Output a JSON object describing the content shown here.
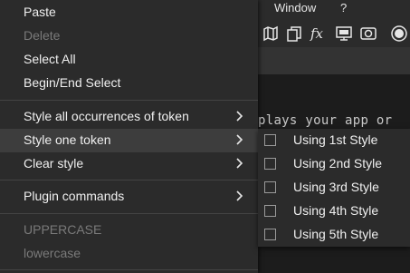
{
  "app": {
    "menubar": {
      "window_label": "Window",
      "help_label": "?"
    },
    "editor_text": "plays your app or"
  },
  "context_menu": {
    "items": [
      {
        "label": "Paste",
        "enabled": true
      },
      {
        "label": "Delete",
        "enabled": false
      },
      {
        "label": "Select All",
        "enabled": true
      },
      {
        "label": "Begin/End Select",
        "enabled": true
      },
      {
        "label": "Style all occurrences of token",
        "enabled": true,
        "submenu": true
      },
      {
        "label": "Style one token",
        "enabled": true,
        "submenu": true,
        "highlighted": true
      },
      {
        "label": "Clear style",
        "enabled": true,
        "submenu": true
      },
      {
        "label": "Plugin commands",
        "enabled": true,
        "submenu": true
      },
      {
        "label": "UPPERCASE",
        "enabled": false
      },
      {
        "label": "lowercase",
        "enabled": false
      }
    ]
  },
  "submenu": {
    "items": [
      {
        "label": "Using 1st Style",
        "checked": false
      },
      {
        "label": "Using 2nd Style",
        "checked": false
      },
      {
        "label": "Using 3rd Style",
        "checked": false
      },
      {
        "label": "Using 4th Style",
        "checked": false
      },
      {
        "label": "Using 5th Style",
        "checked": false
      }
    ]
  },
  "colors": {
    "menu_bg": "#2b2b2b",
    "hover_bg": "#3d3d3d",
    "text": "#f0f0f0",
    "disabled_text": "#7a7a7a"
  },
  "icons": [
    "map-icon",
    "copy-pages-icon",
    "function-fx-icon",
    "monitor-icon",
    "camera-view-icon",
    "record-icon"
  ]
}
